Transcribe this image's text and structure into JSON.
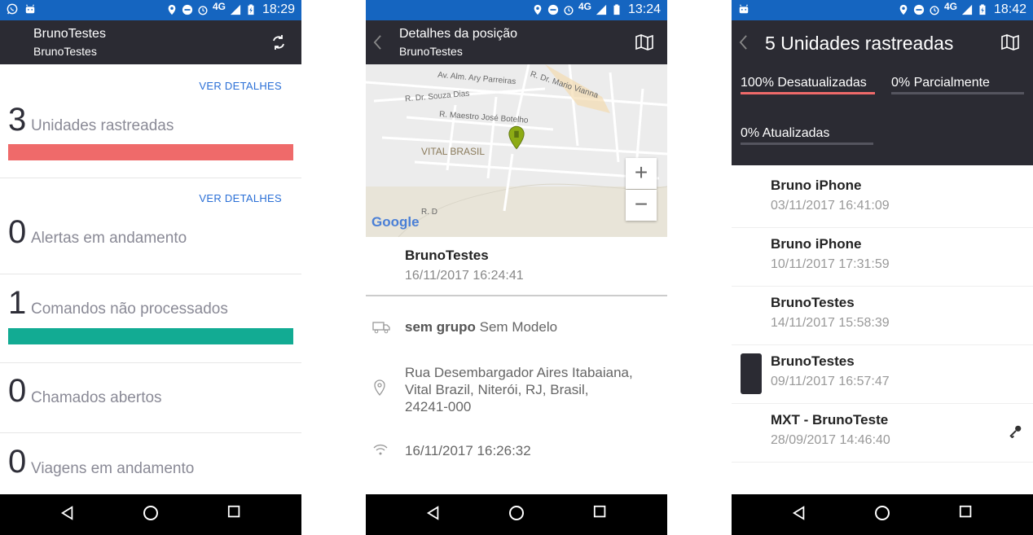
{
  "phones": [
    {
      "status_time": "18:29",
      "network": "4G",
      "appbar": {
        "title": "BrunoTestes",
        "subtitle": "BrunoTestes"
      },
      "cards": [
        {
          "link": "VER DETALHES",
          "count": "3",
          "label": "Unidades rastreadas",
          "bar_color": "#ef6a6a"
        },
        {
          "link": "VER DETALHES",
          "count": "0",
          "label": "Alertas em andamento"
        },
        {
          "count": "1",
          "label": "Comandos não processados",
          "bar_color": "#12ab93"
        },
        {
          "count": "0",
          "label": "Chamados abertos"
        },
        {
          "count": "0",
          "label": "Viagens em andamento"
        }
      ]
    },
    {
      "status_time": "13:24",
      "network": "4G",
      "appbar": {
        "title": "Detalhes da posição",
        "subtitle": "BrunoTestes"
      },
      "map": {
        "streets": [
          "Av. Alm. Ary Parreiras",
          "R. Dr. Mario Vianna",
          "R. Dr. Souza Dias",
          "R. Maestro José Botelho",
          "VITAL BRASIL",
          "R. D"
        ],
        "zoom_in": "+",
        "zoom_out": "−",
        "google_logo": "Google"
      },
      "device": {
        "name": "BrunoTestes",
        "date": "16/11/2017 16:24:41"
      },
      "details": {
        "group": "sem grupo",
        "model": "Sem Modelo",
        "address": [
          "Rua Desembargador Aires Itabaiana,",
          "Vital Brazil, Niterói, RJ, Brasil,",
          "24241-000"
        ],
        "last_comm": "16/11/2017 16:26:32"
      }
    },
    {
      "status_time": "18:42",
      "network": "4G",
      "appbar": {
        "title": "5 Unidades rastreadas"
      },
      "tabs": [
        {
          "label": "100% Desatualizadas",
          "accent": "#ef6a6a"
        },
        {
          "label": "0% Parcialmente"
        },
        {
          "label": "0% Atualizadas"
        }
      ],
      "units": [
        {
          "name": "Bruno iPhone",
          "date": "03/11/2017 16:41:09"
        },
        {
          "name": "Bruno iPhone",
          "date": "10/11/2017 17:31:59"
        },
        {
          "name": "BrunoTestes",
          "date": "14/11/2017 15:58:39"
        },
        {
          "name": "BrunoTestes",
          "date": "09/11/2017 16:57:47"
        },
        {
          "name": "MXT - BrunoTeste",
          "date": "28/09/2017 14:46:40"
        }
      ]
    }
  ],
  "icons": [
    "whatsapp-icon",
    "android-icon",
    "location-icon",
    "dnd-icon",
    "alarm-icon",
    "signal-icon",
    "battery-icon",
    "sync-icon",
    "back-icon",
    "map-icon",
    "truck-icon",
    "pin-icon",
    "wifi-icon",
    "key-icon",
    "nav-back-icon",
    "nav-home-icon",
    "nav-recents-icon"
  ]
}
